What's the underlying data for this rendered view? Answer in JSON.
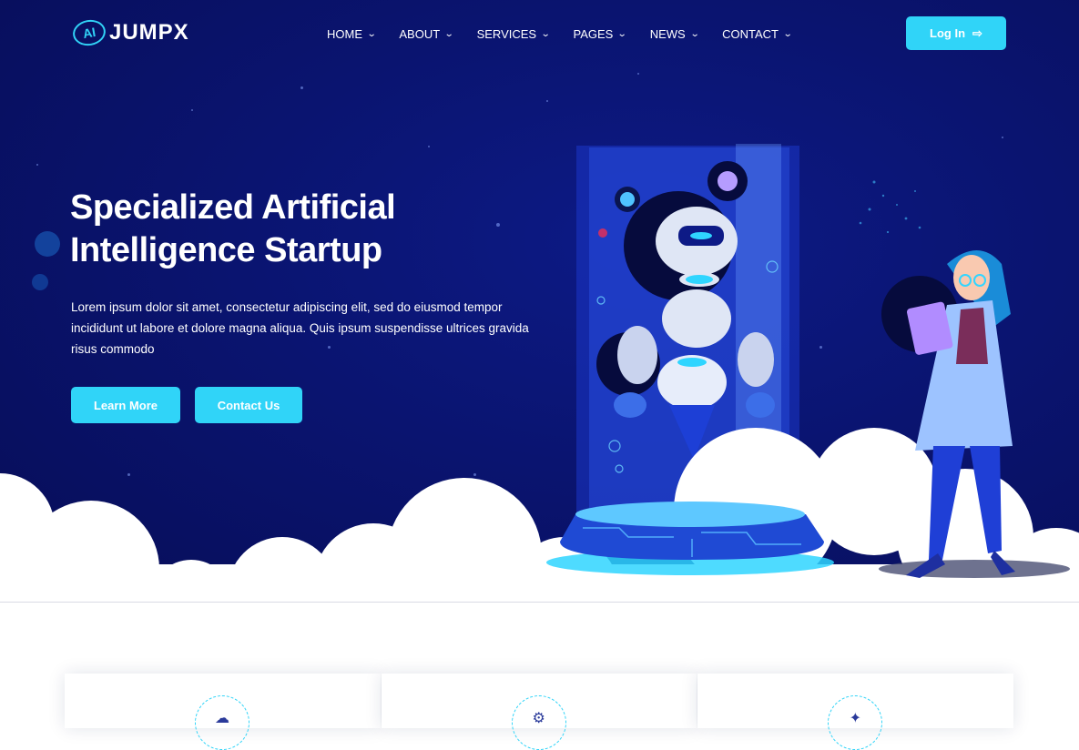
{
  "brand": {
    "logo_mark": "AI",
    "name": "JUMPX"
  },
  "nav": {
    "items": [
      {
        "label": "HOME"
      },
      {
        "label": "ABOUT"
      },
      {
        "label": "SERVICES"
      },
      {
        "label": "PAGES"
      },
      {
        "label": "NEWS"
      },
      {
        "label": "CONTACT"
      }
    ],
    "chevron_icon": "chevron-down-icon"
  },
  "login": {
    "label": "Log In",
    "icon": "sign-in-icon"
  },
  "hero": {
    "title_line1": "Specialized Artificial",
    "title_line2": "Intelligence Startup",
    "description": "Lorem ipsum dolor sit amet, consectetur adipiscing elit, sed do eiusmod tempor incididunt ut labore et dolore magna aliqua. Quis ipsum suspendisse ultrices gravida risus commodo",
    "learn_more_label": "Learn More",
    "contact_label": "Contact Us",
    "illustration": "robot-and-scientist-illustration"
  },
  "features": [
    {
      "icon": "cloud-icon"
    },
    {
      "icon": "robot-icon"
    },
    {
      "icon": "sparkle-icon"
    }
  ],
  "colors": {
    "accent": "#30d4f8",
    "hero_bg": "#0a1470",
    "text_light": "#ffffff"
  }
}
